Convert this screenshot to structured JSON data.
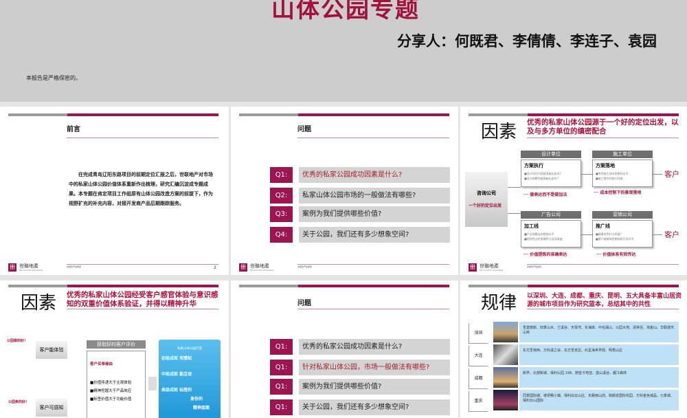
{
  "title_slide": {
    "title": "山体公园专题",
    "sharer": "分享人：何既君、李倩倩、李连子、袁园",
    "confidential": "本报告是严格保密的。"
  },
  "common": {
    "logo_name": "世聯地產",
    "logo_sub": "World Union Properties",
    "footer": "本报告严格保密"
  },
  "slide_preface": {
    "title": "前言",
    "body": "在完成青岛辽阳东路项目的前期定位汇报之后，世联地产对市场中的私家山体公园价值体系重新作出梳理，研究汇编沉淀成专题成果。本专题在肯定项目工作组原有山体公园改造方案的前提下，作为视野扩充的补充内容，对接开发商产品后期跟踪服务。",
    "page": "2"
  },
  "slide_q1": {
    "title": "问题",
    "items": [
      {
        "label": "Q1:",
        "text": "优秀的私家公园成功因素是什么?"
      },
      {
        "label": "Q2:",
        "text": "私家山体公园市场的一般做法有哪些?"
      },
      {
        "label": "Q3:",
        "text": "案例为我们提供哪些价值?"
      },
      {
        "label": "Q4:",
        "text": "关于公园，我们还有多少想象空间?"
      }
    ]
  },
  "slide_factor1": {
    "big": "因素",
    "subtitle": "优秀的私家山体公园源于一个好的定位出发，以及与多方单位的缜密配合",
    "consult": "咨询公司",
    "consult_sub": "一个好的定位出发",
    "customer": "客户",
    "units": [
      {
        "header": "设计单位",
        "title": "方案执行",
        "items": [
          "■设计项目内容能多越出彩吗?",
          "■设计前瞻性越高越出彩吗?"
        ],
        "note": "── 做表达而不是做加法"
      },
      {
        "header": "施工单位",
        "title": "方案落地",
        "items": [
          "■考验施工成本控制的水平",
          "■施工细节的执行程度"
        ],
        "note": "── 成本控制下的景观落地"
      },
      {
        "header": "广告公司",
        "title": "加工线",
        "items": [
          "■产品到概念的提炼水平",
          "■视觉传达的准确性与深浅高度"
        ],
        "note": "── 价值提炼的准确表达"
      },
      {
        "header": "营销公司",
        "title": "推广线",
        "items": [
          "■故事讲到什么程度?",
          "■客户能够体验感知的引导水平"
        ],
        "note": "── 价值体系有效传达"
      }
    ]
  },
  "slide_factor2": {
    "big": "因素",
    "subtitle": "优秀的私家山体公园经受客户感官体验与意识感知的双重价值体系验证，并得以精神升华",
    "tag1": "公园做的好！",
    "tag2": "公园卖的好！",
    "exp1": "客户能体验",
    "exp2": "客户可感知",
    "eval_header": "获取好的客户评价",
    "reason": "客户买单缘由",
    "reasons": [
      "■价值传递大于主观体验",
      "■精神挖掘大于产品效应",
      "■标签价值大于功能价值"
    ],
    "blue_title": "私家山体公园打造",
    "levels": [
      {
        "k": "初级成就",
        "v": "可感知"
      },
      {
        "k": "中级成就",
        "v": "能互动"
      },
      {
        "k": "高级成就",
        "v": "标签的"
      }
    ],
    "extra": [
      "身份的",
      "精神层面"
    ]
  },
  "slide_q2": {
    "title": "问题",
    "items": [
      {
        "label": "Q1:",
        "text": "优秀的私家公园成功因素是什么?"
      },
      {
        "label": "Q1:",
        "text": "针对私家山体公园，市场一般做法有哪些?"
      },
      {
        "label": "Q1:",
        "text": "案例为我们提供哪些价值?"
      },
      {
        "label": "Q1:",
        "text": "关于公园，我们还有多少想象空间?"
      }
    ]
  },
  "slide_rule": {
    "big": "规律",
    "subtitle": "以深圳、大连、成都、重庆、昆明、五大具备丰富山居资源的城市项目作为研究蓝本，总结其中的共性",
    "cities": [
      {
        "name": "深圳",
        "projects": "圣莫丽斯、四季山水、兰溪谷、天琴湾、东海岸、中信澜山、公园大地、清林径、淘金山、华联城市山林"
      },
      {
        "name": "大连",
        "projects": "东方圣荷西、万科溪之谷、东方圣克拉、红星海世界观、明秀山庄"
      },
      {
        "name": "成都",
        "projects": "新界、北部新城、保利公园 198、蔚蓝卡地亚、蓝山溪谷、都江森林"
      },
      {
        "name": "重庆",
        "projects": "同景国际城、坡领畅小镇、保利白云山庄、天籁雨山前、棕榈泉国际花园、万科金色城品、七季城、保利云山国际"
      }
    ]
  }
}
